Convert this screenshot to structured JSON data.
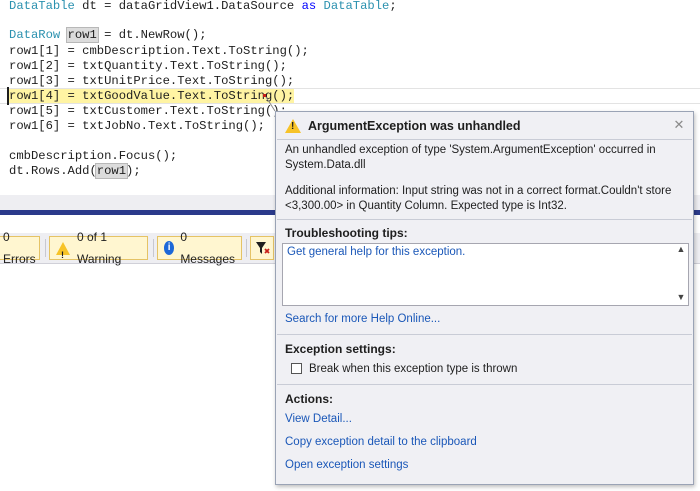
{
  "code": {
    "line1": {
      "type": "DataTable",
      "rest": " dt = dataGridView1.DataSource ",
      "as": "as",
      "type2": "DataTable",
      "end": ";"
    },
    "line2": {
      "type": "DataRow",
      "space": " ",
      "var": "row1",
      "rest": " = dt.NewRow();"
    },
    "line3": "row1[1] = cmbDescription.Text.ToString();",
    "line4": "row1[2] = txtQuantity.Text.ToString();",
    "line5": "row1[3] = txtUnitPrice.Text.ToString();",
    "line6": "row1[4] = txtGoodValue.Text.ToString();",
    "line7": "row1[5] = txtCustomer.Text.ToString();",
    "line8": "row1[6] = txtJobNo.Text.ToString();",
    "line9": "cmbDescription.Focus();",
    "line10": {
      "pre": "dt.Rows.Add(",
      "var": "row1",
      "post": ");"
    }
  },
  "error_list": {
    "errors_label": "0 Errors",
    "warnings_label": "0 of 1 Warning",
    "messages_label": "0 Messages"
  },
  "exception": {
    "title": "ArgumentException was unhandled",
    "message_line1": "An unhandled exception of type 'System.ArgumentException' occurred in",
    "message_line2": "System.Data.dll",
    "info_line1": "Additional information: Input string was not in a correct format.Couldn't store",
    "info_line2": "<3,300.00> in Quantity Column.  Expected type is Int32.",
    "tips_heading": "Troubleshooting tips:",
    "tip_link": "Get general help for this exception.",
    "search_link": "Search for more Help Online...",
    "settings_heading": "Exception settings:",
    "break_label": "Break when this exception type is thrown",
    "actions_heading": "Actions:",
    "action_view_detail": "View Detail...",
    "action_copy": "Copy exception detail to the clipboard",
    "action_open_settings": "Open exception settings"
  },
  "icons": {
    "close": "close-icon",
    "warning": "warning-icon",
    "info": "info-icon",
    "filter": "filter-icon"
  },
  "colors": {
    "highlight": "#fff4a3",
    "keyword_type": "#2b91af",
    "keyword": "#0000ff",
    "link": "#1a57b8",
    "panel_header": "#2b3a8b"
  }
}
